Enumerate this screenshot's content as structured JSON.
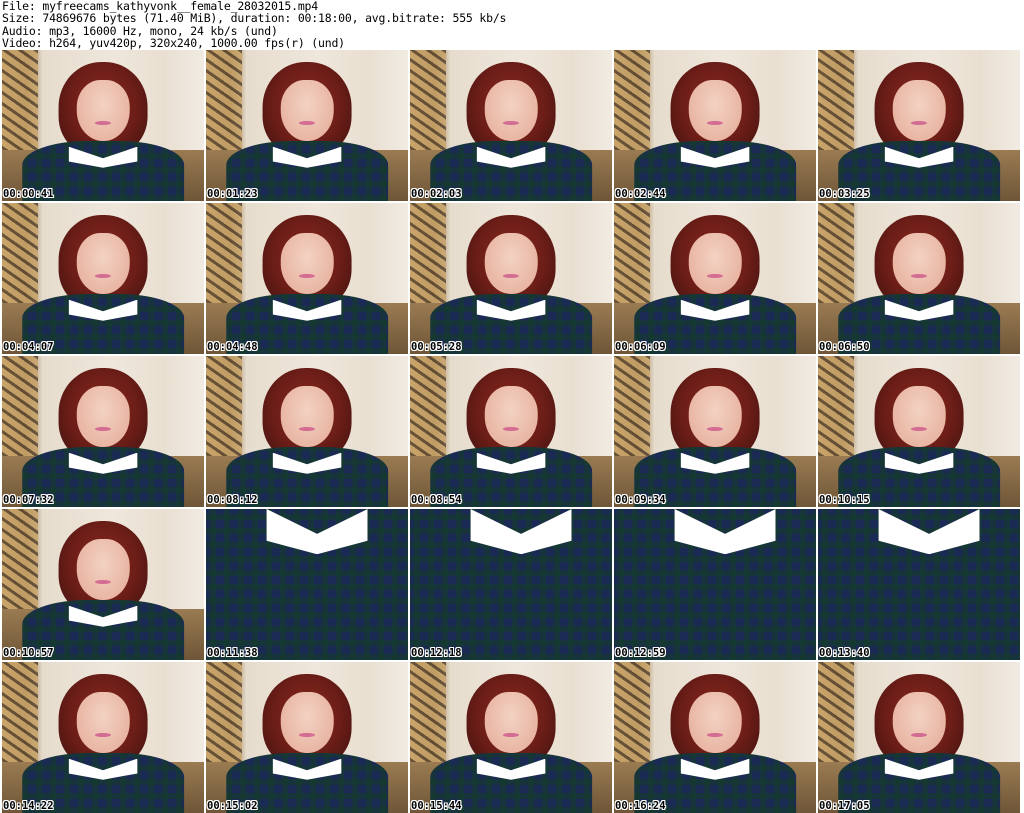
{
  "header": {
    "line1": "File: myfreecams_kathyvonk__female_28032015.mp4",
    "line2": "Size: 74869676 bytes (71.40 MiB), duration: 00:18:00, avg.bitrate: 555 kb/s",
    "line3": "Audio: mp3, 16000 Hz, mono, 24 kb/s (und)",
    "line4": "Video: h264, yuv420p, 320x240, 1000.00 fps(r) (und)"
  },
  "thumbnails": [
    {
      "timestamp": "00:00:41",
      "view": "portrait"
    },
    {
      "timestamp": "00:01:23",
      "view": "portrait"
    },
    {
      "timestamp": "00:02:03",
      "view": "portrait"
    },
    {
      "timestamp": "00:02:44",
      "view": "portrait"
    },
    {
      "timestamp": "00:03:25",
      "view": "portrait"
    },
    {
      "timestamp": "00:04:07",
      "view": "portrait"
    },
    {
      "timestamp": "00:04:48",
      "view": "portrait"
    },
    {
      "timestamp": "00:05:28",
      "view": "portrait"
    },
    {
      "timestamp": "00:06:09",
      "view": "portrait"
    },
    {
      "timestamp": "00:06:50",
      "view": "portrait"
    },
    {
      "timestamp": "00:07:32",
      "view": "portrait"
    },
    {
      "timestamp": "00:08:12",
      "view": "portrait"
    },
    {
      "timestamp": "00:08:54",
      "view": "portrait"
    },
    {
      "timestamp": "00:09:34",
      "view": "portrait"
    },
    {
      "timestamp": "00:10:15",
      "view": "portrait"
    },
    {
      "timestamp": "00:10:57",
      "view": "portrait"
    },
    {
      "timestamp": "00:11:38",
      "view": "closeup"
    },
    {
      "timestamp": "00:12:18",
      "view": "closeup"
    },
    {
      "timestamp": "00:12:59",
      "view": "closeup"
    },
    {
      "timestamp": "00:13:40",
      "view": "closeup"
    },
    {
      "timestamp": "00:14:22",
      "view": "portrait"
    },
    {
      "timestamp": "00:15:02",
      "view": "portrait"
    },
    {
      "timestamp": "00:15:44",
      "view": "portrait"
    },
    {
      "timestamp": "00:16:24",
      "view": "portrait"
    },
    {
      "timestamp": "00:17:05",
      "view": "portrait"
    }
  ]
}
